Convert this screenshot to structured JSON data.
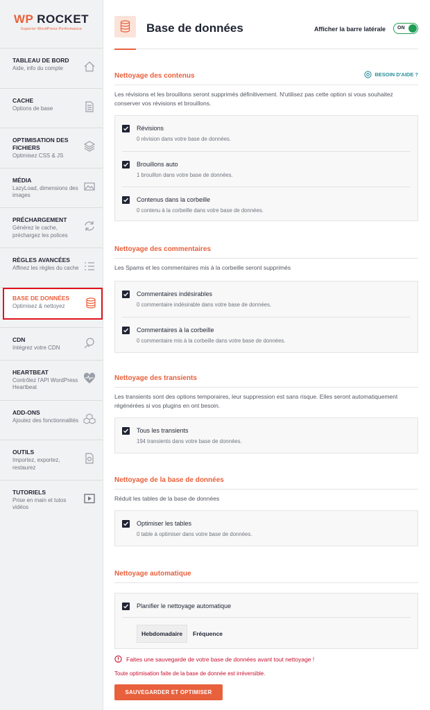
{
  "logo": {
    "wp": "WP",
    "rocket": "ROCKET",
    "tagline": "Superior WordPress Performance"
  },
  "sidebar": {
    "items": [
      {
        "title": "TABLEAU DE BORD",
        "sub": "Aide, info du compte",
        "icon": "home-icon"
      },
      {
        "title": "CACHE",
        "sub": "Options de base",
        "icon": "file-icon"
      },
      {
        "title": "OPTIMISATION DES FICHIERS",
        "sub": "Optimisez CSS & JS",
        "icon": "layers-icon"
      },
      {
        "title": "MÉDIA",
        "sub": "LazyLoad, dimensions des images",
        "icon": "image-icon"
      },
      {
        "title": "PRÉCHARGEMENT",
        "sub": "Générez le cache, préchargez les polices",
        "icon": "refresh-icon"
      },
      {
        "title": "RÈGLES AVANCÉES",
        "sub": "Affinez les règles du cache",
        "icon": "list-icon"
      },
      {
        "title": "BASE DE DONNÉES",
        "sub": "Optimisez & nettoyez",
        "icon": "database-icon",
        "active": true
      },
      {
        "title": "CDN",
        "sub": "Intégrez votre CDN",
        "icon": "cdn-icon"
      },
      {
        "title": "HEARTBEAT",
        "sub": "Contrôlez l'API WordPress Heartbeat",
        "icon": "heartbeat-icon"
      },
      {
        "title": "ADD-ONS",
        "sub": "Ajoutez des fonctionnalités",
        "icon": "cubes-icon"
      },
      {
        "title": "OUTILS",
        "sub": "Importez, exportez, restaurez",
        "icon": "tools-icon"
      },
      {
        "title": "TUTORIELS",
        "sub": "Prise en main et tutos vidéos",
        "icon": "video-icon"
      }
    ]
  },
  "header": {
    "title": "Base de données",
    "sidebar_toggle_label": "Afficher la barre latérale",
    "toggle_state": "ON"
  },
  "sections": {
    "contents": {
      "title": "Nettoyage des contenus",
      "help": "BESOIN D'AIDE ?",
      "desc": "Les révisions et les brouillons seront supprimés définitivement. N'utilisez pas cette option si vous souhaitez conserver vos révisions et brouillons.",
      "options": [
        {
          "label": "Révisions",
          "sub": "0 révision dans votre base de données."
        },
        {
          "label": "Brouillons auto",
          "sub": "1 brouillon dans votre base de données."
        },
        {
          "label": "Contenus dans la corbeille",
          "sub": "0 contenu à la corbeille dans votre base de données."
        }
      ]
    },
    "comments": {
      "title": "Nettoyage des commentaires",
      "desc": "Les Spams et les commentaires mis à la corbeille seront supprimés",
      "options": [
        {
          "label": "Commentaires indésirables",
          "sub": "0 commentaire indésirable dans votre base de données."
        },
        {
          "label": "Commentaires à la corbeille",
          "sub": "0 commentaire mis à la corbeille dans votre base de données."
        }
      ]
    },
    "transients": {
      "title": "Nettoyage des transients",
      "desc": "Les transients sont des options temporaires, leur suppression est sans risque. Elles seront automatiquement régénérées si vos plugins en ont besoin.",
      "options": [
        {
          "label": "Tous les transients",
          "sub": "194 transients dans votre base de données."
        }
      ]
    },
    "database": {
      "title": "Nettoyage de la base de données",
      "desc": "Réduit les tables de la base de données",
      "options": [
        {
          "label": "Optimiser les tables",
          "sub": "0 table à optimiser dans votre base de données."
        }
      ]
    },
    "auto": {
      "title": "Nettoyage automatique",
      "option_label": "Planifier le nettoyage automatique",
      "frequency_value": "Hebdomadaire",
      "frequency_label": "Fréquence"
    }
  },
  "warning": "Faites une sauvegarde de votre base de données avant tout nettoyage !",
  "warning_note": "Toute optimisation faite de la base de donnée est irréversible.",
  "save_button": "SAUVEGARDER ET OPTIMISER",
  "colors": {
    "accent": "#e8603c",
    "dark": "#1f2332",
    "toggle": "#1f9d55",
    "danger": "#c8102e",
    "help": "#2a8f9c"
  }
}
